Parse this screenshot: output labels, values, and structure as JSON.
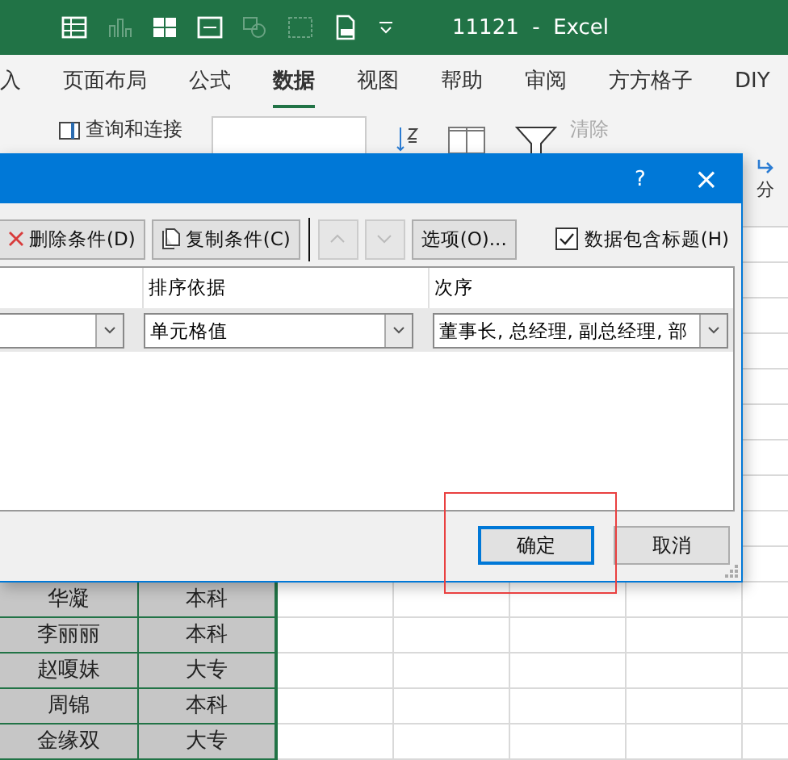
{
  "title_bar": {
    "title": "11121  -  Excel"
  },
  "ribbon_tabs": [
    {
      "label": "入",
      "selected": false
    },
    {
      "label": "页面布局",
      "selected": false
    },
    {
      "label": "公式",
      "selected": false
    },
    {
      "label": "数据",
      "selected": true
    },
    {
      "label": "视图",
      "selected": false
    },
    {
      "label": "帮助",
      "selected": false
    },
    {
      "label": "审阅",
      "selected": false
    },
    {
      "label": "方方格子",
      "selected": false
    },
    {
      "label": "DIY",
      "selected": false
    }
  ],
  "ribbon": {
    "queries_button": "查询和连接",
    "clear_button": {
      "label": "清除",
      "disabled": true
    },
    "side_label": "分"
  },
  "dialog": {
    "help": "?",
    "close": "×",
    "delete_button": "删除条件(D)",
    "copy_button": "复制条件(C)",
    "move_up": {
      "disabled": true
    },
    "move_down": {
      "disabled": true
    },
    "options_button": "选项(O)...",
    "header_checkbox": {
      "label": "数据包含标题(H)",
      "checked": true
    },
    "sort_on_header": "排序依据",
    "order_header": "次序",
    "sort_on": "单元格值",
    "order": "董事长, 总经理, 副总经理, 部",
    "ok_button": {
      "label": "确定",
      "focused": true
    },
    "cancel_button": "取消"
  },
  "sheet_rows": [
    {
      "column_1": "华凝",
      "column_2": "本科"
    },
    {
      "column_1": "李丽丽",
      "column_2": "本科"
    },
    {
      "column_1": "赵嗄妹",
      "column_2": "大专"
    },
    {
      "column_1": "周锦",
      "column_2": "本科"
    },
    {
      "column_1": "金缘双",
      "column_2": "大专"
    }
  ]
}
